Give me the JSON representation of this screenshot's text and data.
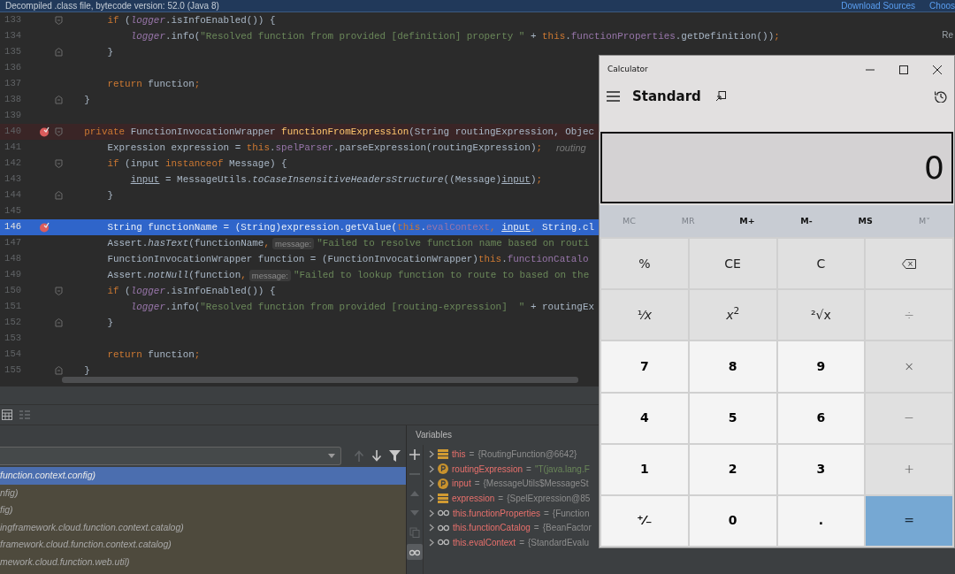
{
  "banner": {
    "text": "Decompiled .class file, bytecode version: 52.0 (Java 8)",
    "links": [
      "Download Sources",
      "Choos"
    ]
  },
  "reader_mode_label": "Re",
  "editor": {
    "lines": [
      {
        "number": "133",
        "kind": "fold-start",
        "breakpoint": false,
        "current": false,
        "parts": [
          {
            "kind": "code",
            "tokens": [
              {
                "kind": "keyword",
                "text": "        if"
              },
              {
                "kind": "plain",
                "text": " ("
              },
              {
                "kind": "static",
                "text": "logger"
              },
              {
                "kind": "plain",
                "text": ".isInfoEnabled()) {"
              }
            ]
          }
        ]
      },
      {
        "number": "134",
        "kind": "plain",
        "breakpoint": false,
        "current": false,
        "parts": [
          {
            "kind": "code",
            "tokens": [
              {
                "kind": "static",
                "text": "            logger"
              },
              {
                "kind": "plain",
                "text": ".info("
              },
              {
                "kind": "string",
                "text": "\"Resolved function from provided [definition] property \""
              },
              {
                "kind": "plain",
                "text": " + "
              },
              {
                "kind": "keyword",
                "text": "this"
              },
              {
                "kind": "plain",
                "text": "."
              },
              {
                "kind": "field",
                "text": "functionProperties"
              },
              {
                "kind": "plain",
                "text": ".getDefinition())"
              },
              {
                "kind": "keyword",
                "text": ";"
              }
            ]
          }
        ]
      },
      {
        "number": "135",
        "kind": "fold-end",
        "breakpoint": false,
        "current": false,
        "parts": [
          {
            "kind": "code",
            "tokens": [
              {
                "kind": "plain",
                "text": "        }"
              }
            ]
          }
        ]
      },
      {
        "number": "136",
        "kind": "plain",
        "breakpoint": false,
        "current": false
      },
      {
        "number": "137",
        "kind": "plain",
        "breakpoint": false,
        "current": false,
        "parts": [
          {
            "kind": "code",
            "tokens": [
              {
                "kind": "keyword",
                "text": "        return"
              },
              {
                "kind": "plain",
                "text": " function"
              },
              {
                "kind": "keyword",
                "text": ";"
              }
            ]
          }
        ]
      },
      {
        "number": "138",
        "kind": "fold-end",
        "breakpoint": false,
        "current": false,
        "parts": [
          {
            "kind": "code",
            "tokens": [
              {
                "kind": "plain",
                "text": "    }"
              }
            ]
          }
        ]
      },
      {
        "number": "139",
        "kind": "plain",
        "breakpoint": false,
        "current": false
      },
      {
        "number": "140",
        "kind": "fold-start",
        "breakpoint": true,
        "current": false,
        "parts": [
          {
            "kind": "code",
            "tokens": [
              {
                "kind": "keyword",
                "text": "    private"
              },
              {
                "kind": "plain",
                "text": " FunctionInvocationWrapper "
              },
              {
                "kind": "method",
                "text": "functionFromExpression"
              },
              {
                "kind": "plain",
                "text": "(String routingExpression, Objec"
              }
            ]
          }
        ]
      },
      {
        "number": "141",
        "kind": "plain",
        "breakpoint": false,
        "current": false,
        "parts": [
          {
            "kind": "code",
            "tokens": [
              {
                "kind": "plain",
                "text": "        Expression expression = "
              },
              {
                "kind": "keyword",
                "text": "this"
              },
              {
                "kind": "plain",
                "text": "."
              },
              {
                "kind": "field",
                "text": "spelParser"
              },
              {
                "kind": "plain",
                "text": ".parseExpression(routingExpression)"
              },
              {
                "kind": "keyword",
                "text": ";"
              }
            ]
          },
          {
            "kind": "inline-value",
            "text": "routing"
          }
        ]
      },
      {
        "number": "142",
        "kind": "fold-start",
        "breakpoint": false,
        "current": false,
        "parts": [
          {
            "kind": "code",
            "tokens": [
              {
                "kind": "keyword",
                "text": "        if"
              },
              {
                "kind": "plain",
                "text": " (input "
              },
              {
                "kind": "keyword",
                "text": "instanceof"
              },
              {
                "kind": "plain",
                "text": " Message) {"
              }
            ]
          }
        ]
      },
      {
        "number": "143",
        "kind": "plain",
        "breakpoint": false,
        "current": false,
        "parts": [
          {
            "kind": "code",
            "tokens": [
              {
                "kind": "reassigned",
                "text": "            input"
              },
              {
                "kind": "plain",
                "text": " = MessageUtils."
              },
              {
                "kind": "italic",
                "text": "toCaseInsensitiveHeadersStructure"
              },
              {
                "kind": "plain",
                "text": "((Message)"
              },
              {
                "kind": "reassigned",
                "text": "input"
              },
              {
                "kind": "plain",
                "text": ")"
              },
              {
                "kind": "keyword",
                "text": ";"
              }
            ]
          }
        ]
      },
      {
        "number": "144",
        "kind": "fold-end",
        "breakpoint": false,
        "current": false,
        "parts": [
          {
            "kind": "code",
            "tokens": [
              {
                "kind": "plain",
                "text": "        }"
              }
            ]
          }
        ]
      },
      {
        "number": "145",
        "kind": "plain",
        "breakpoint": false,
        "current": false
      },
      {
        "number": "146",
        "kind": "plain",
        "breakpoint": true,
        "current": true,
        "parts": [
          {
            "kind": "code",
            "tokens": [
              {
                "kind": "plain",
                "text": "        String functionName = (String)expression.getValue("
              },
              {
                "kind": "keyword",
                "text": "this"
              },
              {
                "kind": "plain",
                "text": "."
              },
              {
                "kind": "field",
                "text": "evalContext"
              },
              {
                "kind": "keyword",
                "text": ", "
              },
              {
                "kind": "reassigned",
                "text": "input"
              },
              {
                "kind": "keyword",
                "text": ", "
              },
              {
                "kind": "plain",
                "text": "String.cl"
              }
            ]
          }
        ]
      },
      {
        "number": "147",
        "kind": "plain",
        "breakpoint": false,
        "current": false,
        "parts": [
          {
            "kind": "code",
            "tokens": [
              {
                "kind": "plain",
                "text": "        Assert."
              },
              {
                "kind": "italic",
                "text": "hasText"
              },
              {
                "kind": "plain",
                "text": "(functionName"
              },
              {
                "kind": "keyword",
                "text": ","
              }
            ]
          },
          {
            "kind": "hint",
            "text": "message:"
          },
          {
            "kind": "code",
            "tokens": [
              {
                "kind": "string",
                "text": "\"Failed to resolve function name based on routi"
              }
            ]
          }
        ]
      },
      {
        "number": "148",
        "kind": "plain",
        "breakpoint": false,
        "current": false,
        "parts": [
          {
            "kind": "code",
            "tokens": [
              {
                "kind": "plain",
                "text": "        FunctionInvocationWrapper function = (FunctionInvocationWrapper)"
              },
              {
                "kind": "keyword",
                "text": "this"
              },
              {
                "kind": "plain",
                "text": "."
              },
              {
                "kind": "field",
                "text": "functionCatalo"
              }
            ]
          }
        ]
      },
      {
        "number": "149",
        "kind": "plain",
        "breakpoint": false,
        "current": false,
        "parts": [
          {
            "kind": "code",
            "tokens": [
              {
                "kind": "plain",
                "text": "        Assert."
              },
              {
                "kind": "italic",
                "text": "notNull"
              },
              {
                "kind": "plain",
                "text": "(function"
              },
              {
                "kind": "keyword",
                "text": ","
              }
            ]
          },
          {
            "kind": "hint",
            "text": "message:"
          },
          {
            "kind": "code",
            "tokens": [
              {
                "kind": "string",
                "text": "\"Failed to lookup function to route to based on the"
              }
            ]
          }
        ]
      },
      {
        "number": "150",
        "kind": "fold-start",
        "breakpoint": false,
        "current": false,
        "parts": [
          {
            "kind": "code",
            "tokens": [
              {
                "kind": "keyword",
                "text": "        if"
              },
              {
                "kind": "plain",
                "text": " ("
              },
              {
                "kind": "static",
                "text": "logger"
              },
              {
                "kind": "plain",
                "text": ".isInfoEnabled()) {"
              }
            ]
          }
        ]
      },
      {
        "number": "151",
        "kind": "plain",
        "breakpoint": false,
        "current": false,
        "parts": [
          {
            "kind": "code",
            "tokens": [
              {
                "kind": "static",
                "text": "            logger"
              },
              {
                "kind": "plain",
                "text": ".info("
              },
              {
                "kind": "string",
                "text": "\"Resolved function from provided [routing-expression]  \""
              },
              {
                "kind": "plain",
                "text": " + routingEx"
              }
            ]
          }
        ]
      },
      {
        "number": "152",
        "kind": "fold-end",
        "breakpoint": false,
        "current": false,
        "parts": [
          {
            "kind": "code",
            "tokens": [
              {
                "kind": "plain",
                "text": "        }"
              }
            ]
          }
        ]
      },
      {
        "number": "153",
        "kind": "plain",
        "breakpoint": false,
        "current": false
      },
      {
        "number": "154",
        "kind": "plain",
        "breakpoint": false,
        "current": false,
        "parts": [
          {
            "kind": "code",
            "tokens": [
              {
                "kind": "keyword",
                "text": "        return"
              },
              {
                "kind": "plain",
                "text": " function"
              },
              {
                "kind": "keyword",
                "text": ";"
              }
            ]
          }
        ]
      },
      {
        "number": "155",
        "kind": "fold-end",
        "breakpoint": false,
        "current": false,
        "parts": [
          {
            "kind": "code",
            "tokens": [
              {
                "kind": "plain",
                "text": "    }"
              }
            ]
          }
        ]
      }
    ]
  },
  "debugger": {
    "toolbar": [
      {
        "kind": "table",
        "disabled": false
      },
      {
        "kind": "list",
        "disabled": true
      }
    ],
    "frames": {
      "nav": [
        {
          "kind": "up",
          "disabled": true
        },
        {
          "kind": "down",
          "disabled": false
        },
        {
          "kind": "filter",
          "disabled": false
        }
      ],
      "items": [
        {
          "text": "function.context.config)",
          "selected": true
        },
        {
          "text": "nfig)",
          "selected": false
        },
        {
          "text": "fig)",
          "selected": false
        },
        {
          "text": "ingframework.cloud.function.context.catalog)",
          "selected": false
        },
        {
          "text": "framework.cloud.function.context.catalog)",
          "selected": false
        },
        {
          "text": "mework.cloud.function.web.util)",
          "selected": false
        }
      ]
    },
    "variables": {
      "title": "Variables",
      "tools": [
        {
          "kind": "add",
          "disabled": false,
          "on": false
        },
        {
          "kind": "remove",
          "disabled": true,
          "on": false
        },
        {
          "kind": "up",
          "disabled": true,
          "on": false
        },
        {
          "kind": "down",
          "disabled": true,
          "on": false
        },
        {
          "kind": "copy",
          "disabled": true,
          "on": false
        },
        {
          "kind": "watches",
          "disabled": false,
          "on": true
        }
      ],
      "items": [
        {
          "kind": "field",
          "name": "this",
          "equals": "=",
          "value": "{RoutingFunction@6642}",
          "is_string": false
        },
        {
          "kind": "parameter",
          "name": "routingExpression",
          "equals": "=",
          "value": "\"T(java.lang.F",
          "is_string": true
        },
        {
          "kind": "parameter",
          "name": "input",
          "equals": "=",
          "value": "{MessageUtils$MessageSt",
          "is_string": false
        },
        {
          "kind": "field",
          "name": "expression",
          "equals": "=",
          "value": "{SpelExpression@85",
          "is_string": false
        },
        {
          "kind": "watch",
          "name": "this.functionProperties",
          "equals": "=",
          "value": "{Function",
          "is_string": false
        },
        {
          "kind": "watch",
          "name": "this.functionCatalog",
          "equals": "=",
          "value": "{BeanFactor",
          "is_string": false
        },
        {
          "kind": "watch",
          "name": "this.evalContext",
          "equals": "=",
          "value": "{StandardEvalu",
          "is_string": false
        }
      ]
    }
  },
  "calculator": {
    "title": "Calculator",
    "mode": "Standard",
    "display": "0",
    "memory": [
      {
        "label": "MC",
        "disabled": true
      },
      {
        "label": "MR",
        "disabled": true
      },
      {
        "label": "M+",
        "disabled": false
      },
      {
        "label": "M-",
        "disabled": false
      },
      {
        "label": "MS",
        "disabled": false
      },
      {
        "label": "M˅",
        "disabled": true
      }
    ],
    "keys": [
      {
        "kind": "function",
        "label": "%"
      },
      {
        "kind": "function",
        "label": "CE"
      },
      {
        "kind": "function",
        "label": "C"
      },
      {
        "kind": "backspace"
      },
      {
        "kind": "function",
        "label": "¹⁄*x*"
      },
      {
        "kind": "function",
        "label": "*x*$^{2}$"
      },
      {
        "kind": "function",
        "label": "²√x"
      },
      {
        "kind": "operator",
        "label": "÷"
      },
      {
        "kind": "digit",
        "label": "7"
      },
      {
        "kind": "digit",
        "label": "8"
      },
      {
        "kind": "digit",
        "label": "9"
      },
      {
        "kind": "operator",
        "label": "×"
      },
      {
        "kind": "digit",
        "label": "4"
      },
      {
        "kind": "digit",
        "label": "5"
      },
      {
        "kind": "digit",
        "label": "6"
      },
      {
        "kind": "operator",
        "label": "−"
      },
      {
        "kind": "digit",
        "label": "1"
      },
      {
        "kind": "digit",
        "label": "2"
      },
      {
        "kind": "digit",
        "label": "3"
      },
      {
        "kind": "operator",
        "label": "+"
      },
      {
        "kind": "digit",
        "label": "⁺⁄₋"
      },
      {
        "kind": "digit",
        "label": "0"
      },
      {
        "kind": "digit",
        "label": "."
      },
      {
        "kind": "equals",
        "label": "="
      }
    ]
  }
}
